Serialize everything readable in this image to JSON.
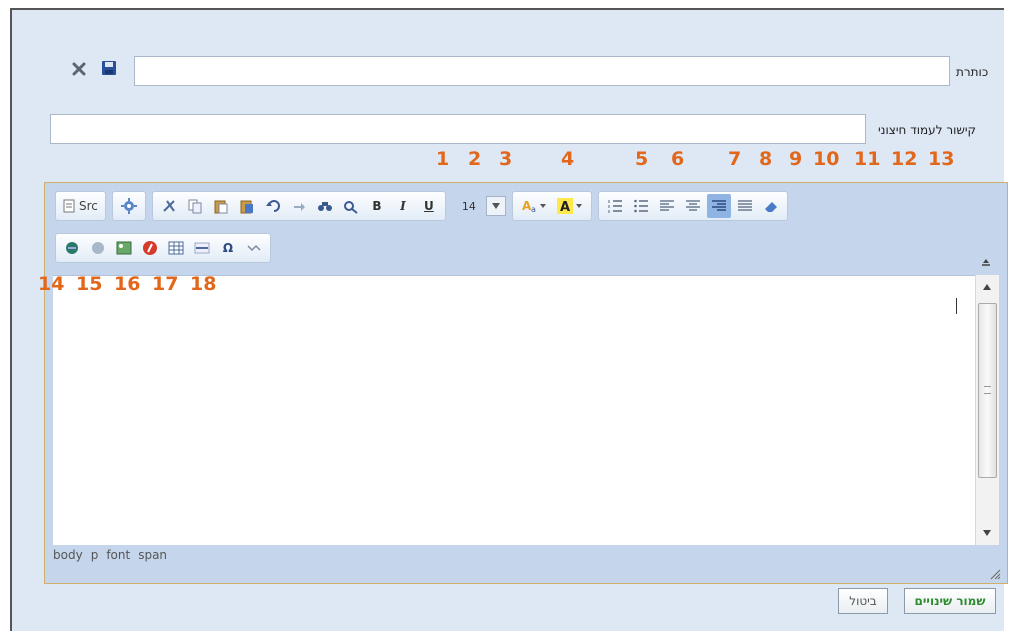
{
  "form": {
    "title_label": "כותרת",
    "title_value": "",
    "link_label": "קישור לעמוד חיצוני",
    "link_value": ""
  },
  "annotations": {
    "top_numbers": [
      "1",
      "2",
      "3",
      "4",
      "5",
      "6",
      "7",
      "8",
      "9",
      "10",
      "11",
      "12",
      "13"
    ],
    "bottom_numbers": [
      "14",
      "15",
      "16",
      "17",
      "18"
    ]
  },
  "toolbar": {
    "source_label": "Src",
    "font_size": "14"
  },
  "statusbar": {
    "path": [
      "body",
      "p",
      "font",
      "span"
    ]
  },
  "buttons": {
    "save": "שמור שינויים",
    "cancel": "ביטול"
  },
  "colors": {
    "annotation": "#e3671b",
    "panel_bg": "#dde8f4",
    "save_text": "#2d8a2d"
  }
}
